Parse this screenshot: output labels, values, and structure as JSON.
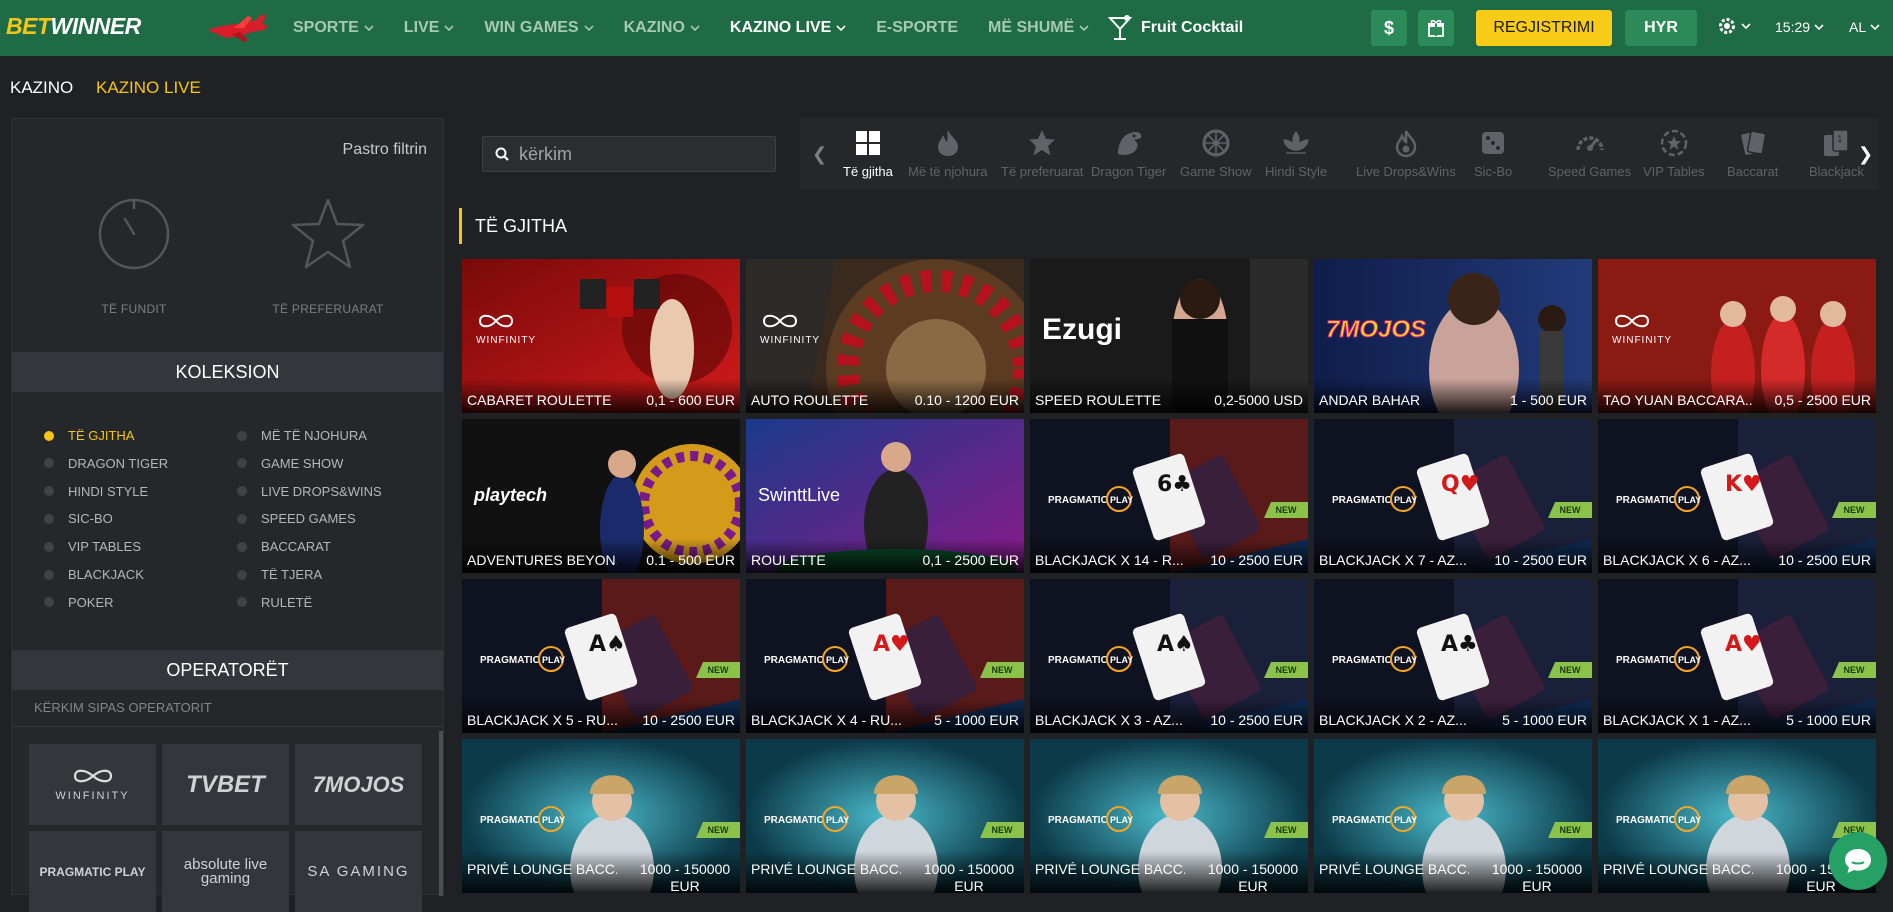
{
  "brand": {
    "bet": "BET",
    "winner": "WINNER"
  },
  "nav": [
    {
      "label": "SPORTE",
      "chevron": true,
      "active": false
    },
    {
      "label": "LIVE",
      "chevron": true,
      "active": false
    },
    {
      "label": "WIN GAMES",
      "chevron": true,
      "active": false
    },
    {
      "label": "KAZINO",
      "chevron": true,
      "active": false
    },
    {
      "label": "KAZINO LIVE",
      "chevron": true,
      "active": true
    },
    {
      "label": "E-SPORTE",
      "chevron": false,
      "active": false
    },
    {
      "label": "MË SHUMË",
      "chevron": true,
      "active": false
    }
  ],
  "promo": {
    "label": "Fruit Cocktail"
  },
  "header": {
    "dollar": "$",
    "register": "REGJISTRIMI",
    "login": "HYR",
    "time": "15:29",
    "lang": "AL"
  },
  "subnav": {
    "kazino": "KAZINO",
    "kazino_live": "KAZINO LIVE"
  },
  "sidebar": {
    "clear_filter": "Pastro filtrin",
    "recent": "TË FUNDIT",
    "favorites": "TË PREFERUARAT",
    "collection_title": "KOLEKSION",
    "collection": [
      {
        "label": "TË GJITHA",
        "active": true
      },
      {
        "label": "MË TË NJOHURA",
        "active": false
      },
      {
        "label": "DRAGON TIGER",
        "active": false
      },
      {
        "label": "GAME SHOW",
        "active": false
      },
      {
        "label": "HINDI STYLE",
        "active": false
      },
      {
        "label": "LIVE DROPS&WINS",
        "active": false
      },
      {
        "label": "SIC-BO",
        "active": false
      },
      {
        "label": "SPEED GAMES",
        "active": false
      },
      {
        "label": "VIP TABLES",
        "active": false
      },
      {
        "label": "BACCARAT",
        "active": false
      },
      {
        "label": "BLACKJACK",
        "active": false
      },
      {
        "label": "TË TJERA",
        "active": false
      },
      {
        "label": "POKER",
        "active": false
      },
      {
        "label": "RULETË",
        "active": false
      }
    ],
    "operators_title": "OPERATORËT",
    "operator_search_placeholder": "KËRKIM SIPAS OPERATORIT",
    "operators": [
      "WINFINITY",
      "TVBET",
      "7MOJOS",
      "PRAGMATIC PLAY",
      "absolute live gaming",
      "SA GAMING"
    ]
  },
  "search": {
    "placeholder": "kërkim"
  },
  "categories": [
    {
      "label": "Të gjitha",
      "icon": "grid-icon",
      "active": true
    },
    {
      "label": "Më të njohura",
      "icon": "flame-icon",
      "active": false
    },
    {
      "label": "Të preferuarat",
      "icon": "star-icon",
      "active": false
    },
    {
      "label": "Dragon Tiger",
      "icon": "dragon-icon",
      "active": false
    },
    {
      "label": "Game Show",
      "icon": "wheel-icon",
      "active": false
    },
    {
      "label": "Hindi Style",
      "icon": "lotus-icon",
      "active": false
    },
    {
      "label": "Live Drops&Wins",
      "icon": "drop-flame-icon",
      "active": false
    },
    {
      "label": "Sic-Bo",
      "icon": "dice-icon",
      "active": false
    },
    {
      "label": "Speed Games",
      "icon": "speedometer-icon",
      "active": false
    },
    {
      "label": "VIP Tables",
      "icon": "vip-star-icon",
      "active": false
    },
    {
      "label": "Baccarat",
      "icon": "cards-icon",
      "active": false
    },
    {
      "label": "Blackjack",
      "icon": "blackjack-cards-icon",
      "active": false
    }
  ],
  "section_title": "TË GJITHA",
  "games": [
    {
      "name": "CABARET ROULETTE",
      "range": "0,1 - 600 EUR",
      "provider": "WINFINITY",
      "new": false,
      "theme": "red"
    },
    {
      "name": "AUTO ROULETTE",
      "range": "0.10 - 1200 EUR",
      "provider": "WINFINITY",
      "new": false,
      "theme": "wheel"
    },
    {
      "name": "SPEED ROULETTE",
      "range": "0,2-5000 USD",
      "provider": "Ezugi",
      "new": false,
      "theme": "dark"
    },
    {
      "name": "ANDAR BAHAR",
      "range": "1 - 500 EUR",
      "provider": "7MOJOS",
      "new": false,
      "theme": "blue"
    },
    {
      "name": "TAO YUAN BACCARA...",
      "range": "0,5 - 2500 EUR",
      "provider": "WINFINITY",
      "new": false,
      "theme": "redgirls"
    },
    {
      "name": "ADVENTURES BEYON...",
      "range": "0.1 - 500 EUR",
      "provider": "playtech",
      "new": false,
      "theme": "wonder"
    },
    {
      "name": "ROULETTE",
      "range": "0,1 - 2500 EUR",
      "provider": "SwinttLive",
      "new": false,
      "theme": "purple"
    },
    {
      "name": "BLACKJACK X 14 - R...",
      "range": "10 - 2500 EUR",
      "provider": "PRAGMATIC PLAY",
      "new": true,
      "theme": "bjred",
      "card": "6♣"
    },
    {
      "name": "BLACKJACK X 7 - AZ...",
      "range": "10 - 2500 EUR",
      "provider": "PRAGMATIC PLAY",
      "new": true,
      "theme": "bjblue",
      "card": "Q♥"
    },
    {
      "name": "BLACKJACK X 6 - AZ...",
      "range": "10 - 2500 EUR",
      "provider": "PRAGMATIC PLAY",
      "new": true,
      "theme": "bjblue",
      "card": "K♥"
    },
    {
      "name": "BLACKJACK X 5 - RU...",
      "range": "10 - 2500 EUR",
      "provider": "PRAGMATIC PLAY",
      "new": true,
      "theme": "bjred",
      "card": "A♠"
    },
    {
      "name": "BLACKJACK X 4 - RU...",
      "range": "5 - 1000 EUR",
      "provider": "PRAGMATIC PLAY",
      "new": true,
      "theme": "bjred",
      "card": "A♥"
    },
    {
      "name": "BLACKJACK X 3 - AZ...",
      "range": "10 - 2500 EUR",
      "provider": "PRAGMATIC PLAY",
      "new": true,
      "theme": "bjblue",
      "card": "A♠"
    },
    {
      "name": "BLACKJACK X 2 - AZ...",
      "range": "5 - 1000 EUR",
      "provider": "PRAGMATIC PLAY",
      "new": true,
      "theme": "bjblue",
      "card": "A♣"
    },
    {
      "name": "BLACKJACK X 1 - AZ...",
      "range": "5 - 1000 EUR",
      "provider": "PRAGMATIC PLAY",
      "new": true,
      "theme": "bjblue",
      "card": "A♥"
    },
    {
      "name": "PRIVÉ LOUNGE BACC...",
      "range": "1000 - 150000 EUR",
      "provider": "PRAGMATIC PLAY",
      "new": true,
      "theme": "teal"
    },
    {
      "name": "PRIVÉ LOUNGE BACC...",
      "range": "1000 - 150000 EUR",
      "provider": "PRAGMATIC PLAY",
      "new": true,
      "theme": "teal"
    },
    {
      "name": "PRIVÉ LOUNGE BACC...",
      "range": "1000 - 150000 EUR",
      "provider": "PRAGMATIC PLAY",
      "new": true,
      "theme": "teal"
    },
    {
      "name": "PRIVÉ LOUNGE BACC...",
      "range": "1000 - 150000 EUR",
      "provider": "PRAGMATIC PLAY",
      "new": true,
      "theme": "teal"
    },
    {
      "name": "PRIVÉ LOUNGE BACC...",
      "range": "1000 - 150000 EUR",
      "provider": "PRAGMATIC PLAY",
      "new": true,
      "theme": "teal"
    }
  ],
  "new_badge": "NEW",
  "colors": {
    "brand_green": "#1e6b45",
    "accent_yellow": "#f5c518",
    "bg_dark": "#1f2124"
  }
}
